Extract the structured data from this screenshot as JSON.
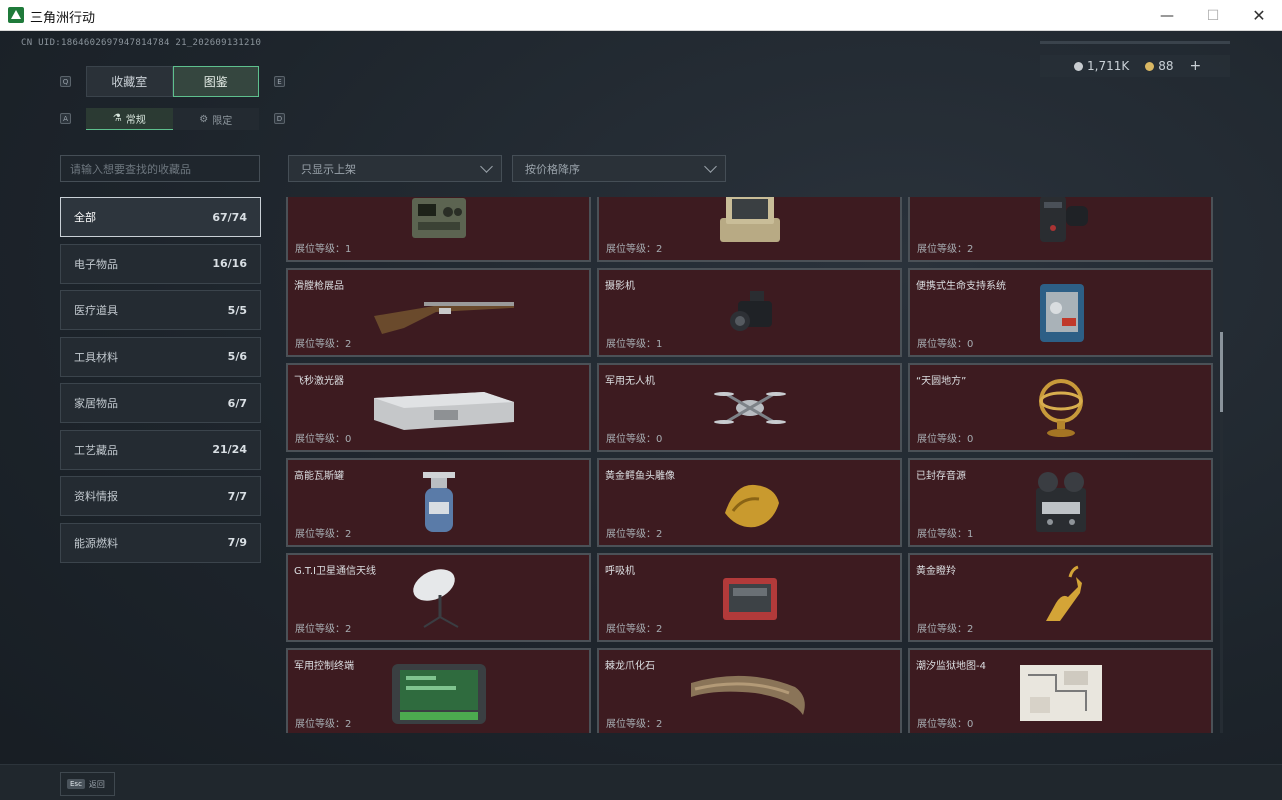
{
  "window": {
    "title": "三角洲行动",
    "minimize": "—",
    "maximize": "☐",
    "close": "✕"
  },
  "header": {
    "cnuid": "CN UID:1864602697947814784 21_202609131210",
    "currency": [
      {
        "icon": "silver-coin-icon",
        "value": "1,711K"
      },
      {
        "icon": "gold-coin-icon",
        "value": "88"
      }
    ],
    "add": "+"
  },
  "tabs": {
    "hint_left": "Q",
    "hint_right": "E",
    "items": [
      {
        "label": "收藏室",
        "active": false
      },
      {
        "label": "图鉴",
        "active": true
      }
    ]
  },
  "subtabs": {
    "hint_left": "A",
    "hint_right": "D",
    "items": [
      {
        "label": "常规",
        "icon": "flask-icon",
        "active": true
      },
      {
        "label": "限定",
        "icon": "badge-icon",
        "active": false
      }
    ]
  },
  "search": {
    "placeholder": "请输入想要查找的收藏品"
  },
  "filters": {
    "shelf": "只显示上架",
    "sort": "按价格降序"
  },
  "categories": [
    {
      "label": "全部",
      "count": "67/74",
      "active": true
    },
    {
      "label": "电子物品",
      "count": "16/16",
      "active": false
    },
    {
      "label": "医疗道具",
      "count": "5/5",
      "active": false
    },
    {
      "label": "工具材料",
      "count": "5/6",
      "active": false
    },
    {
      "label": "家居物品",
      "count": "6/7",
      "active": false
    },
    {
      "label": "工艺藏品",
      "count": "21/24",
      "active": false
    },
    {
      "label": "资料情报",
      "count": "7/7",
      "active": false
    },
    {
      "label": "能源燃料",
      "count": "7/9",
      "active": false
    }
  ],
  "items": [
    {
      "name": "",
      "level": "展位等级：1",
      "icon": "radio-icon"
    },
    {
      "name": "",
      "level": "展位等级：2",
      "icon": "field-terminal-icon"
    },
    {
      "name": "",
      "level": "展位等级：2",
      "icon": "tactical-device-icon"
    },
    {
      "name": "滑膛枪展品",
      "level": "展位等级：2",
      "icon": "musket-icon"
    },
    {
      "name": "摄影机",
      "level": "展位等级：1",
      "icon": "camera-icon"
    },
    {
      "name": "便携式生命支持系统",
      "level": "展位等级：0",
      "icon": "life-support-icon"
    },
    {
      "name": "飞秒激光器",
      "level": "展位等级：0",
      "icon": "laser-case-icon"
    },
    {
      "name": "军用无人机",
      "level": "展位等级：0",
      "icon": "drone-icon"
    },
    {
      "name": "“天圆地方”",
      "level": "展位等级：0",
      "icon": "armillary-sphere-icon"
    },
    {
      "name": "高能瓦斯罐",
      "level": "展位等级：2",
      "icon": "gas-tank-icon"
    },
    {
      "name": "黄金鳄鱼头雕像",
      "level": "展位等级：2",
      "icon": "gold-crocodile-icon"
    },
    {
      "name": "已封存音源",
      "level": "展位等级：1",
      "icon": "tape-recorder-icon"
    },
    {
      "name": "G.T.I卫星通信天线",
      "level": "展位等级：2",
      "icon": "satellite-dish-icon"
    },
    {
      "name": "呼吸机",
      "level": "展位等级：2",
      "icon": "ventilator-icon"
    },
    {
      "name": "黄金瞪羚",
      "level": "展位等级：2",
      "icon": "gold-gazelle-icon"
    },
    {
      "name": "军用控制终端",
      "level": "展位等级：2",
      "icon": "control-terminal-icon"
    },
    {
      "name": "棘龙爪化石",
      "level": "展位等级：2",
      "icon": "claw-fossil-icon"
    },
    {
      "name": "潮汐监狱地图-4",
      "level": "展位等级：0",
      "icon": "map-icon"
    }
  ],
  "footer": {
    "esc": "Esc",
    "back": "返回"
  }
}
